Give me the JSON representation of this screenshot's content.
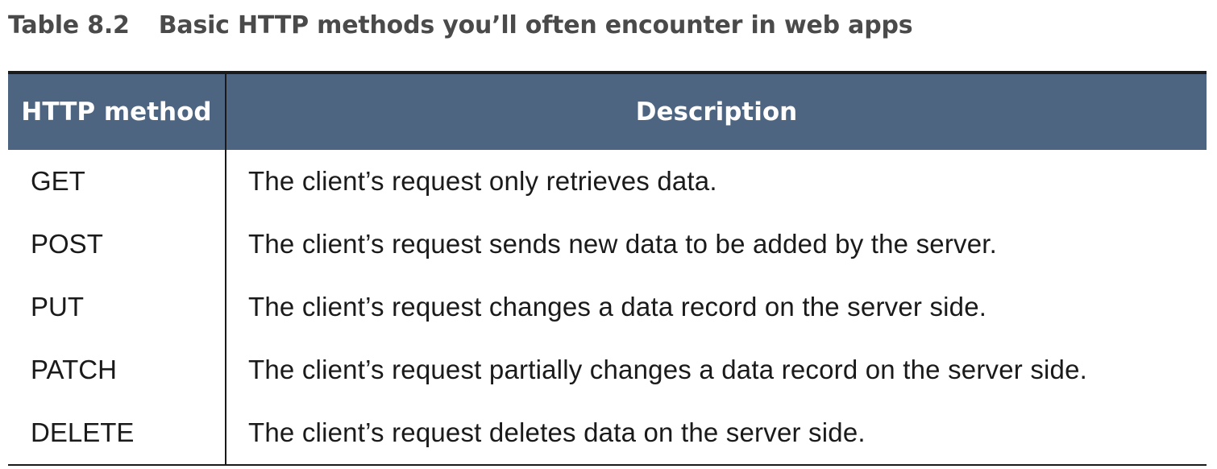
{
  "caption": {
    "number": "Table 8.2",
    "title": "Basic HTTP methods you’ll often encounter in web apps"
  },
  "table": {
    "headers": [
      "HTTP method",
      "Description"
    ],
    "rows": [
      [
        "GET",
        "The client’s request only retrieves data."
      ],
      [
        "POST",
        "The client’s request sends new data to be added by the server."
      ],
      [
        "PUT",
        "The client’s request changes a data record on the server side."
      ],
      [
        "PATCH",
        "The client’s request partially changes a data record on the server side."
      ],
      [
        "DELETE",
        "The client’s request deletes data on the server side."
      ]
    ]
  },
  "colors": {
    "header_background": "#4d6580",
    "header_text": "#ffffff",
    "caption_text": "#4a4a4a",
    "rule": "#1a1a1a"
  }
}
